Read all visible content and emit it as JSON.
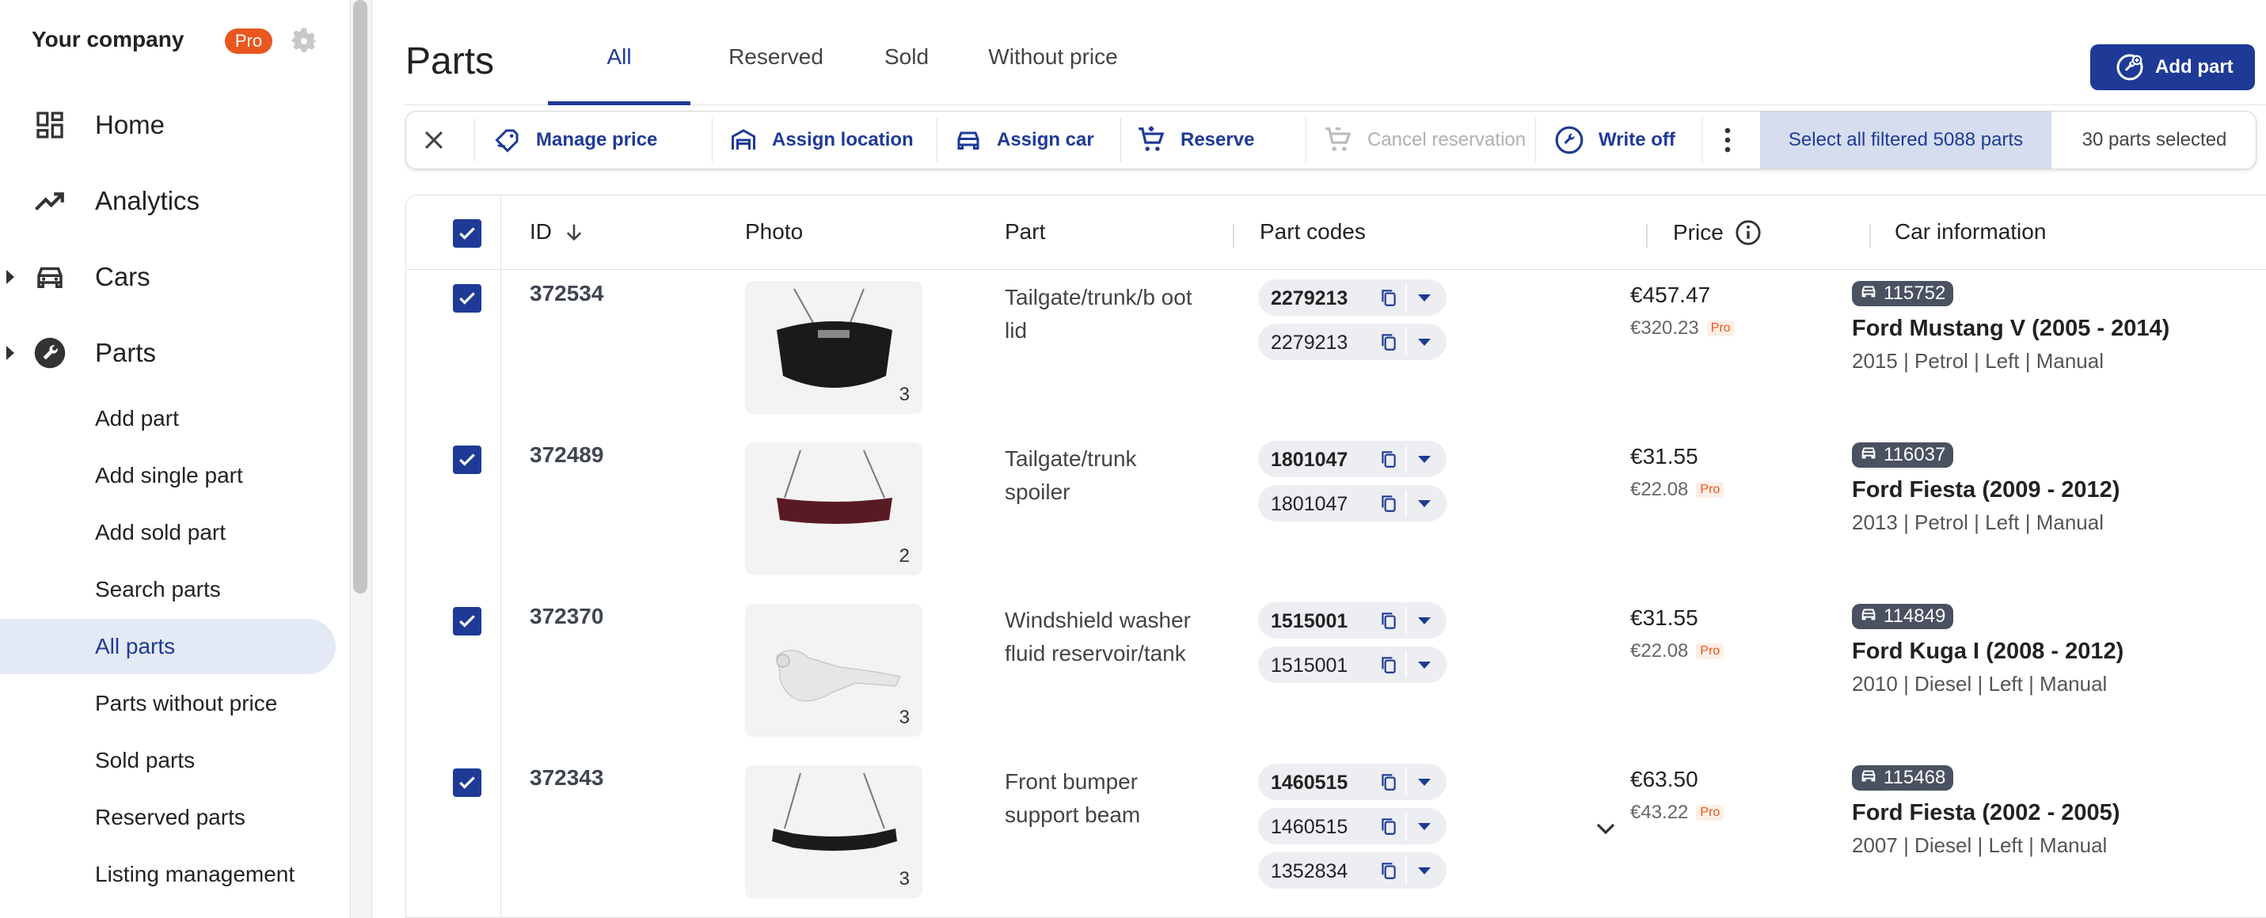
{
  "sidebar": {
    "company": "Your company",
    "pro_badge": "Pro",
    "nav": [
      {
        "label": "Home",
        "icon": "dashboard-icon"
      },
      {
        "label": "Analytics",
        "icon": "trending-up-icon"
      },
      {
        "label": "Cars",
        "icon": "car-icon",
        "expandable": true
      },
      {
        "label": "Parts",
        "icon": "wrench-icon",
        "expandable": true
      }
    ],
    "parts_sub": [
      {
        "label": "Add part"
      },
      {
        "label": "Add single part"
      },
      {
        "label": "Add sold part"
      },
      {
        "label": "Search parts"
      },
      {
        "label": "All parts",
        "active": true
      },
      {
        "label": "Parts without price"
      },
      {
        "label": "Sold parts"
      },
      {
        "label": "Reserved parts"
      },
      {
        "label": "Listing management"
      }
    ]
  },
  "header": {
    "title": "Parts",
    "tabs": [
      {
        "label": "All",
        "active": true
      },
      {
        "label": "Reserved"
      },
      {
        "label": "Sold"
      },
      {
        "label": "Without price"
      }
    ],
    "add_part_label": "Add part"
  },
  "action_bar": {
    "manage_price": "Manage price",
    "assign_location": "Assign location",
    "assign_car": "Assign car",
    "reserve": "Reserve",
    "cancel_reservation": "Cancel reservation",
    "write_off": "Write off",
    "select_all": "Select all filtered 5088 parts",
    "selected_count": "30 parts selected"
  },
  "table": {
    "columns": {
      "id": "ID",
      "photo": "Photo",
      "part": "Part",
      "part_codes": "Part codes",
      "price": "Price",
      "car_information": "Car information"
    },
    "rows": [
      {
        "id": "372534",
        "photo_count": "3",
        "part": "Tailgate/trunk/b oot lid",
        "codes": [
          "2279213",
          "2279213"
        ],
        "price": "€457.47",
        "pro_price": "€320.23",
        "pro_tag": "Pro",
        "car_id": "115752",
        "car_name": "Ford Mustang V (2005 - 2014)",
        "car_details": "2015 | Petrol | Left | Manual"
      },
      {
        "id": "372489",
        "photo_count": "2",
        "part": "Tailgate/trunk spoiler",
        "codes": [
          "1801047",
          "1801047"
        ],
        "price": "€31.55",
        "pro_price": "€22.08",
        "pro_tag": "Pro",
        "car_id": "116037",
        "car_name": "Ford Fiesta (2009 - 2012)",
        "car_details": "2013 | Petrol | Left | Manual"
      },
      {
        "id": "372370",
        "photo_count": "3",
        "part": "Windshield washer fluid reservoir/tank",
        "codes": [
          "1515001",
          "1515001"
        ],
        "price": "€31.55",
        "pro_price": "€22.08",
        "pro_tag": "Pro",
        "car_id": "114849",
        "car_name": "Ford Kuga I (2008 - 2012)",
        "car_details": "2010 | Diesel | Left | Manual"
      },
      {
        "id": "372343",
        "photo_count": "3",
        "part": "Front bumper support beam",
        "codes": [
          "1460515",
          "1460515",
          "1352834"
        ],
        "price": "€63.50",
        "pro_price": "€43.22",
        "pro_tag": "Pro",
        "car_id": "115468",
        "car_name": "Ford Fiesta (2002 - 2005)",
        "car_details": "2007 | Diesel | Left | Manual"
      }
    ]
  },
  "colors": {
    "accent": "#1e3a96",
    "pro": "#e8571f",
    "active_bg": "#e4e9f6"
  }
}
